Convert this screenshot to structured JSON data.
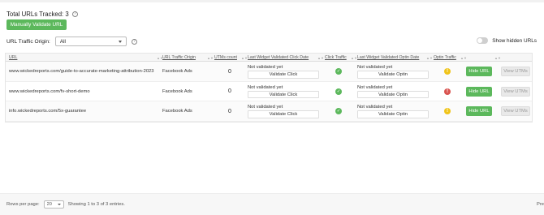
{
  "header": {
    "total_label": "Total URLs Tracked: 3",
    "validate_button": "Manually Validate URL"
  },
  "filter": {
    "origin_label": "URL Traffic Origin:",
    "origin_value": "All",
    "toggle_label": "Show hidden URLs"
  },
  "table": {
    "columns": {
      "url": "URL",
      "origin": "URL Traffic Origin",
      "utms": "UTMs count",
      "last_click": "Last Widget Validated Click Date",
      "click_traffic": "Click Traffic",
      "last_optin": "Last Widget Validated Optin Date",
      "optin_traffic": "Optin Traffic"
    },
    "rows": [
      {
        "url": "www.wickedreports.com/guide-to-accurate-marketing-attribution-2023",
        "origin": "Facebook Ads",
        "utms": "0",
        "click_status": "Not validated yet",
        "click_button": "Validate Click",
        "optin_status": "Not validated yet",
        "optin_button": "Validate Optin",
        "hide_button": "Hide URL",
        "utm_button": "View UTMs"
      },
      {
        "url": "www.wickedreports.com/fv-short-demo",
        "origin": "Facebook Ads",
        "utms": "0",
        "click_status": "Not validated yet",
        "click_button": "Validate Click",
        "optin_status": "Not validated yet",
        "optin_button": "Validate Optin",
        "hide_button": "Hide URL",
        "utm_button": "View UTMs"
      },
      {
        "url": "info.wickedreports.com/5x-guarantee",
        "origin": "Facebook Ads",
        "utms": "0",
        "click_status": "Not validated yet",
        "click_button": "Validate Click",
        "optin_status": "Not validated yet",
        "optin_button": "Validate Optin",
        "hide_button": "Hide URL",
        "utm_button": "View UTMs"
      }
    ]
  },
  "footer": {
    "rows_per_page_label": "Rows per page:",
    "rows_per_page_value": "20",
    "showing": "Showing 1 to 3 of 3 entries.",
    "prev": "Pre"
  },
  "colors": {
    "accent_green": "#5cb85c",
    "warning": "#f0c419",
    "error": "#d9534f"
  }
}
